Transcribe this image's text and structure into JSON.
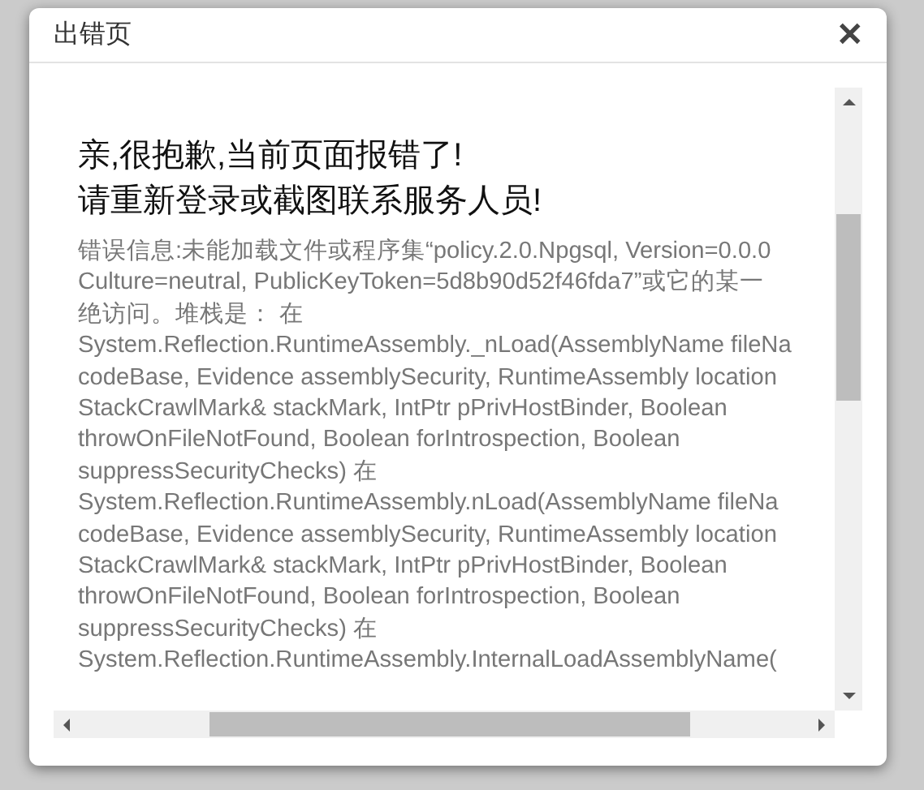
{
  "dialog": {
    "title": "出错页",
    "close": "✕"
  },
  "message": {
    "lines": [
      "亲,很抱歉,当前页面报错了!",
      "请重新登录或截图联系服务人员!"
    ]
  },
  "error_details": {
    "lines": [
      "错误信息:未能加载文件或程序集“policy.2.0.Npgsql, Version=0.0.0",
      "Culture=neutral, PublicKeyToken=5d8b90d52f46fda7”或它的某一",
      "绝访问。堆栈是： 在",
      "System.Reflection.RuntimeAssembly._nLoad(AssemblyName fileNa",
      "codeBase, Evidence assemblySecurity, RuntimeAssembly location",
      "StackCrawlMark& stackMark, IntPtr pPrivHostBinder, Boolean",
      "throwOnFileNotFound, Boolean forIntrospection, Boolean",
      "suppressSecurityChecks) 在",
      "System.Reflection.RuntimeAssembly.nLoad(AssemblyName fileNa",
      "codeBase, Evidence assemblySecurity, RuntimeAssembly location",
      "StackCrawlMark& stackMark, IntPtr pPrivHostBinder, Boolean",
      "throwOnFileNotFound, Boolean forIntrospection, Boolean",
      "suppressSecurityChecks) 在",
      "System.Reflection.RuntimeAssembly.InternalLoadAssemblyName("
    ]
  }
}
